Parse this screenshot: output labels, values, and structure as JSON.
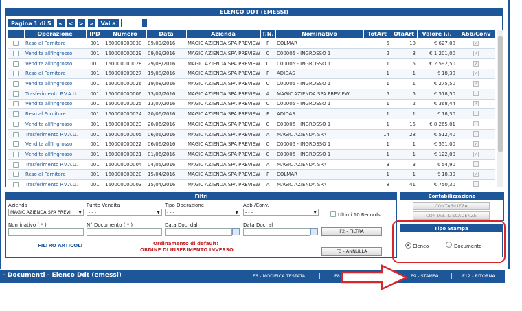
{
  "grid": {
    "title": "ELENCO DDT (EMESSI)",
    "pager": {
      "page_label": "Pagina 1 di 5",
      "first": "«",
      "prev": "<",
      "next": ">",
      "last": "»",
      "goto": "Vai a"
    },
    "columns": [
      "",
      "Operazione",
      "IPD",
      "Numero",
      "Data",
      "Azienda",
      "T.N.",
      "Nominativo",
      "TotArt",
      "QtàArt",
      "Valore i.i.",
      "Abb/Conv"
    ],
    "rows": [
      {
        "op": "Reso al Fornitore",
        "ipd": "001",
        "num": "160000000030",
        "data": "09/09/2016",
        "az": "MAGIC AZIENDA SPA PREVIEW",
        "tn": "F",
        "nom": "COLMAR",
        "tot": "5",
        "qta": "10",
        "val": "€ 627,08",
        "conv": true
      },
      {
        "op": "Vendita all'Ingrosso",
        "ipd": "001",
        "num": "160000000029",
        "data": "09/09/2016",
        "az": "MAGIC AZIENDA SPA PREVIEW",
        "tn": "C",
        "nom": "C00005 - INGROSSO 1",
        "tot": "2",
        "qta": "3",
        "val": "€ 1.201,00",
        "conv": true
      },
      {
        "op": "Vendita all'Ingrosso",
        "ipd": "001",
        "num": "160000000028",
        "data": "29/08/2016",
        "az": "MAGIC AZIENDA SPA PREVIEW",
        "tn": "C",
        "nom": "C00005 - INGROSSO 1",
        "tot": "1",
        "qta": "5",
        "val": "€ 2.592,50",
        "conv": true
      },
      {
        "op": "Reso al Fornitore",
        "ipd": "001",
        "num": "160000000027",
        "data": "19/08/2016",
        "az": "MAGIC AZIENDA SPA PREVIEW",
        "tn": "F",
        "nom": "ADIDAS",
        "tot": "1",
        "qta": "1",
        "val": "€ 18,30",
        "conv": true
      },
      {
        "op": "Vendita all'Ingrosso",
        "ipd": "001",
        "num": "160000000026",
        "data": "19/08/2016",
        "az": "MAGIC AZIENDA SPA PREVIEW",
        "tn": "C",
        "nom": "C00005 - INGROSSO 1",
        "tot": "1",
        "qta": "1",
        "val": "€ 275,50",
        "conv": true
      },
      {
        "op": "Trasferimento P.V.A.U.",
        "ipd": "001",
        "num": "160000000006",
        "data": "13/07/2016",
        "az": "MAGIC AZIENDA SPA PREVIEW",
        "tn": "A",
        "nom": "MAGIC AZIENDA SPA PREVIEW",
        "tot": "5",
        "qta": "5",
        "val": "€ 518,50",
        "conv": false
      },
      {
        "op": "Vendita all'Ingrosso",
        "ipd": "001",
        "num": "160000000025",
        "data": "13/07/2016",
        "az": "MAGIC AZIENDA SPA PREVIEW",
        "tn": "C",
        "nom": "C00005 - INGROSSO 1",
        "tot": "1",
        "qta": "2",
        "val": "€ 368,44",
        "conv": true
      },
      {
        "op": "Reso al Fornitore",
        "ipd": "001",
        "num": "160000000024",
        "data": "20/06/2016",
        "az": "MAGIC AZIENDA SPA PREVIEW",
        "tn": "F",
        "nom": "ADIDAS",
        "tot": "1",
        "qta": "1",
        "val": "€ 18,30",
        "conv": false
      },
      {
        "op": "Vendita all'Ingrosso",
        "ipd": "001",
        "num": "160000000023",
        "data": "20/06/2016",
        "az": "MAGIC AZIENDA SPA PREVIEW",
        "tn": "C",
        "nom": "C00005 - INGROSSO 1",
        "tot": "1",
        "qta": "15",
        "val": "€ 8.265,01",
        "conv": false
      },
      {
        "op": "Trasferimento P.V.A.U.",
        "ipd": "001",
        "num": "160000000005",
        "data": "06/06/2016",
        "az": "MAGIC AZIENDA SPA PREVIEW",
        "tn": "A",
        "nom": "MAGIC AZIENDA SPA",
        "tot": "14",
        "qta": "28",
        "val": "€ 512,40",
        "conv": false
      },
      {
        "op": "Vendita all'Ingrosso",
        "ipd": "001",
        "num": "160000000022",
        "data": "06/06/2016",
        "az": "MAGIC AZIENDA SPA PREVIEW",
        "tn": "C",
        "nom": "C00005 - INGROSSO 1",
        "tot": "1",
        "qta": "1",
        "val": "€ 551,00",
        "conv": true
      },
      {
        "op": "Vendita all'Ingrosso",
        "ipd": "001",
        "num": "160000000021",
        "data": "01/06/2016",
        "az": "MAGIC AZIENDA SPA PREVIEW",
        "tn": "C",
        "nom": "C00005 - INGROSSO 1",
        "tot": "1",
        "qta": "1",
        "val": "€ 122,00",
        "conv": true
      },
      {
        "op": "Trasferimento P.V.A.U.",
        "ipd": "001",
        "num": "160000000004",
        "data": "04/05/2016",
        "az": "MAGIC AZIENDA SPA PREVIEW",
        "tn": "A",
        "nom": "MAGIC AZIENDA SPA",
        "tot": "3",
        "qta": "3",
        "val": "€ 54,90",
        "conv": false
      },
      {
        "op": "Reso al Fornitore",
        "ipd": "001",
        "num": "160000000020",
        "data": "15/04/2016",
        "az": "MAGIC AZIENDA SPA PREVIEW",
        "tn": "F",
        "nom": "COLMAR",
        "tot": "1",
        "qta": "1",
        "val": "€ 18,30",
        "conv": true
      },
      {
        "op": "Trasferimento P.V.A.U.",
        "ipd": "001",
        "num": "160000000003",
        "data": "15/04/2016",
        "az": "MAGIC AZIENDA SPA PREVIEW",
        "tn": "A",
        "nom": "MAGIC AZIENDA SPA",
        "tot": "8",
        "qta": "41",
        "val": "€ 750,30",
        "conv": false
      }
    ]
  },
  "filters": {
    "title": "Filtri",
    "azienda_label": "Azienda",
    "azienda_value": "MAGIC AZIENDA SPA PREVI",
    "punto_vendita_label": "Punto Vendita",
    "punto_vendita_value": "- - -",
    "tipo_operazione_label": "Tipo Operazione",
    "tipo_operazione_value": "- - -",
    "abb_conv_label": "Abb./Conv.",
    "abb_conv_value": "- - -",
    "ultimi_label": "Ultimi 10 Records",
    "nominativo_label": "Nominativo ( * )",
    "num_documento_label": "N° Documento ( * )",
    "data_dal_label": "Data Doc. dal",
    "data_al_label": "Data Doc. al",
    "filtra_button": "F2 - FILTRA",
    "annulla_button": "F3 - ANNULLA",
    "filtro_articoli": "FILTRO ARTICOLI",
    "ordinamento_line1": "Ordinamento di default:",
    "ordinamento_line2": "ORDINE DI INSERIMENTO INVERSO"
  },
  "contab": {
    "title": "Contabilizzazione",
    "contabilizza_button": "CONTABILIZZA",
    "scadenze_button": "CONTAB. & SCADENZE"
  },
  "stampa": {
    "title": "Tipo Stampa",
    "elenco_label": "Elenco",
    "documento_label": "Documento",
    "selected": "Elenco"
  },
  "statusbar": {
    "title": "- Documenti - Elenco Ddt (emessi)",
    "f6": "F6 - MODIFICA TESTATA",
    "f8": "F8",
    "f9": "F9 - STAMPA",
    "f12": "F12 - RITORNA",
    "separator": "|"
  },
  "colors": {
    "primary": "#1e5799",
    "highlight": "#d7262c"
  }
}
